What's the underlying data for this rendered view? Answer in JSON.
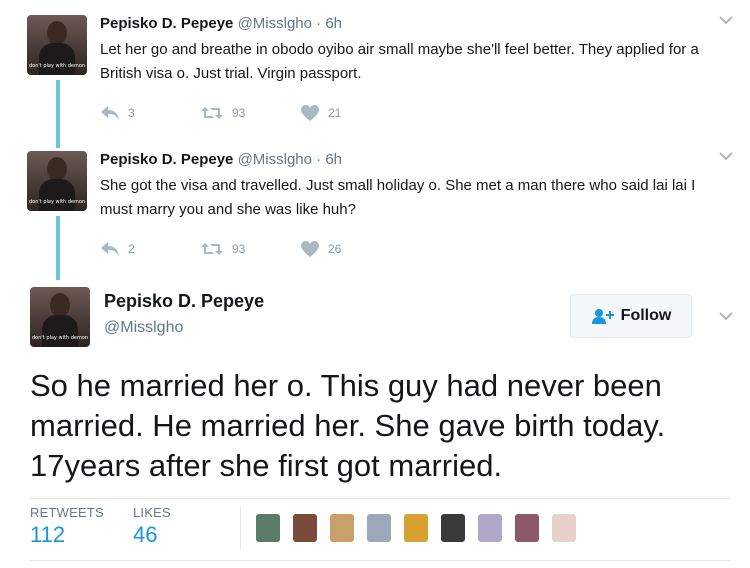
{
  "tweets": [
    {
      "name": "Pepisko D. Pepeye",
      "handle": "@Misslgho",
      "separator": "·",
      "time": "6h",
      "text": "Let her go and breathe in obodo oyibo air small maybe she'll feel better. They applied for a British visa o. Just trial. Virgin passport.",
      "replies": "3",
      "retweets": "93",
      "likes": "21",
      "avatar_caption": "don't play with demons"
    },
    {
      "name": "Pepisko D. Pepeye",
      "handle": "@Misslgho",
      "separator": "·",
      "time": "6h",
      "text": "She got the visa and travelled. Just small holiday o. She met a man there who said lai lai I must marry you and she was like huh?",
      "replies": "2",
      "retweets": "93",
      "likes": "26",
      "avatar_caption": "don't play with demons"
    }
  ],
  "main_tweet": {
    "name": "Pepisko D. Pepeye",
    "handle": "@Misslgho",
    "follow_label": "Follow",
    "text": "So he married her o. This guy had never been married. He married her. She gave birth today. 17years after she first got married.",
    "avatar_caption": "don't play with demons",
    "retweets_label": "RETWEETS",
    "retweets_value": "112",
    "likes_label": "LIKES",
    "likes_value": "46",
    "liker_colors": [
      "#5a7a6a",
      "#7a4a3a",
      "#c9a06a",
      "#9aa8b8",
      "#d8a030",
      "#3a3a3a",
      "#b0a8c8",
      "#8a5a6a",
      "#e8d0c8"
    ]
  },
  "colors": {
    "thread_line": "#6bc6db",
    "accent": "#1b95e0",
    "like": "#e0245e",
    "icon_gray": "#aab8c2"
  },
  "icons": {
    "reply": "reply-icon",
    "retweet": "retweet-icon",
    "like": "heart-icon",
    "caret": "chevron-down-icon",
    "follow": "follow-person-plus-icon"
  }
}
